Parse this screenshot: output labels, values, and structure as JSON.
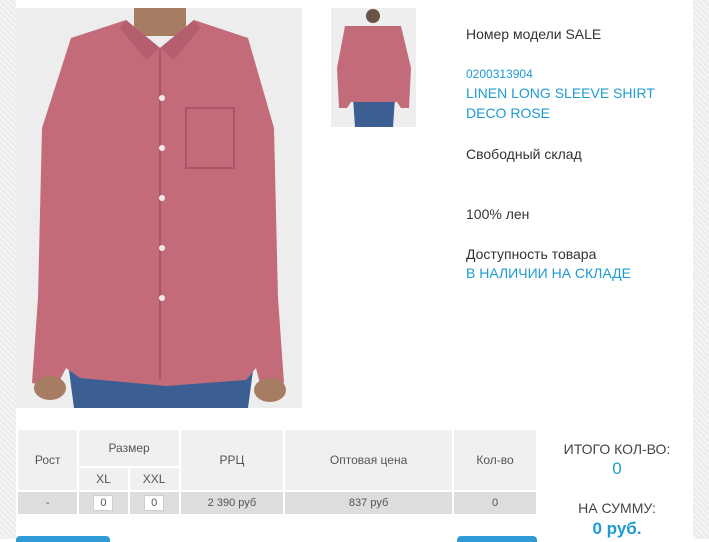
{
  "product": {
    "model_label": "Номер модели SALE",
    "sku": "0200313904",
    "name_line1": "LINEN LONG SLEEVE SHIRT",
    "name_line2": "DECO ROSE",
    "fit": "Свободный склад",
    "material": "100% лен",
    "availability_label": "Доступность товара",
    "availability_value": "В НАЛИЧИИ НА СКЛАДЕ"
  },
  "table": {
    "headers": {
      "height": "Рост",
      "size": "Размер",
      "size_xl": "XL",
      "size_xxl": "XXL",
      "rrp": "РРЦ",
      "wholesale": "Оптовая цена",
      "qty": "Кол-во"
    },
    "row": {
      "height": "-",
      "qty_xl": "0",
      "qty_xxl": "0",
      "rrp": "2 390 руб",
      "wholesale": "837 руб",
      "qty": "0"
    }
  },
  "totals": {
    "qty_label": "ИТОГО КОЛ-ВО:",
    "qty_value": "0",
    "sum_label": "НА СУММУ:",
    "sum_value": "0 руб."
  },
  "colors": {
    "accent": "#1e9bd3",
    "shirt": "#c46b7a",
    "jeans": "#3c5f93"
  }
}
